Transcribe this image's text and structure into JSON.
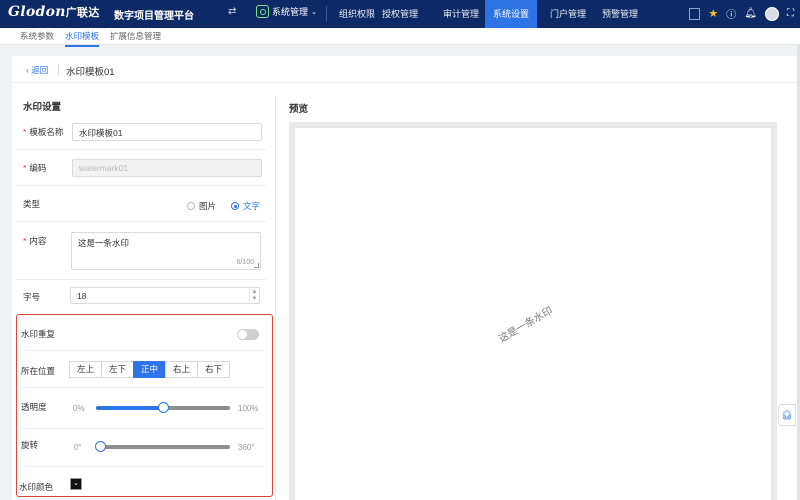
{
  "brand": {
    "logo": "Glodon",
    "logo_cn": "广联达",
    "platform": "数字项目管理平台"
  },
  "top_nav": {
    "system_switch": "系统管理",
    "items": [
      "组织权限",
      "授权管理",
      "审计管理",
      "系统设置",
      "门户管理",
      "预警管理"
    ],
    "active": "系统设置"
  },
  "tabs": {
    "items": [
      "系统参数",
      "水印模板",
      "扩展信息管理"
    ],
    "active": "水印模板"
  },
  "header": {
    "back_label": "返回",
    "title": "水印模板01"
  },
  "form": {
    "section_title": "水印设置",
    "name_label": "模板名称",
    "name_value": "水印模板01",
    "code_label": "编码",
    "code_placeholder": "watermark01",
    "type_label": "类型",
    "type_options": [
      "图片",
      "文字"
    ],
    "type_selected": "文字",
    "content_label": "内容",
    "content_value": "这是一条水印",
    "content_counter": "6/100",
    "fontsize_label": "字号",
    "fontsize_value": "18",
    "repeat_label": "水印重复",
    "repeat_enabled": false,
    "position_label": "所在位置",
    "position_options": [
      "左上",
      "左下",
      "正中",
      "右上",
      "右下"
    ],
    "position_selected": "正中",
    "opacity_label": "透明度",
    "opacity_min": "0%",
    "opacity_max": "100%",
    "opacity_value": 0.5,
    "rotation_label": "旋转",
    "rotation_min": "0°",
    "rotation_max": "360°",
    "rotation_value": 0.03,
    "color_label": "水印颜色",
    "color_value": "#111111"
  },
  "preview": {
    "title": "预览",
    "watermark_text": "这是一条水印"
  },
  "colors": {
    "topbar": "#0d2a66",
    "accent": "#2f74e6",
    "highlight": "#d94a36"
  }
}
